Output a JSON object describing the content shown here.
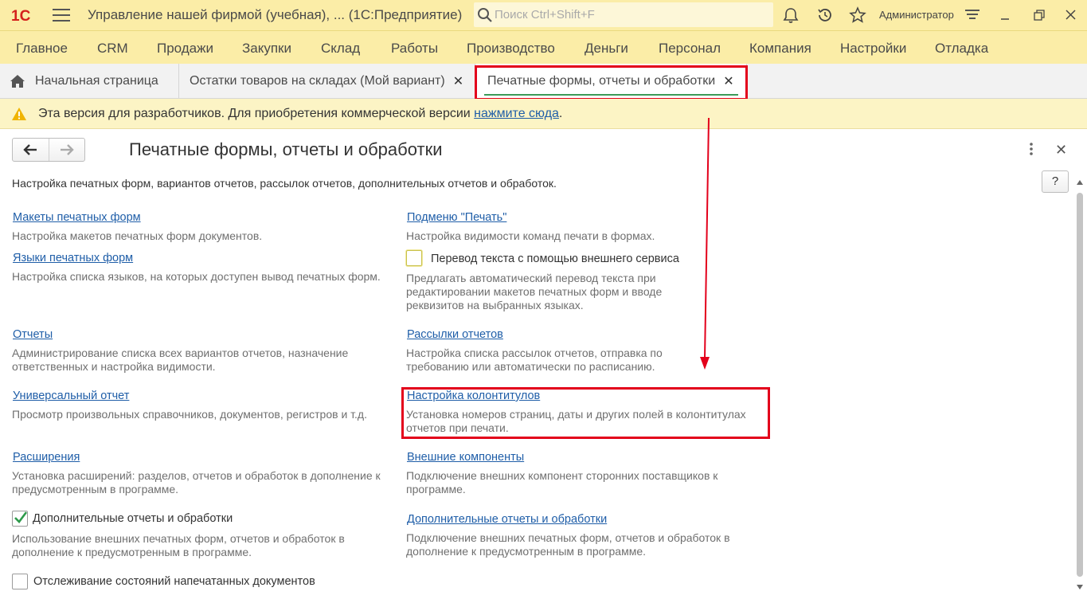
{
  "window": {
    "title": "Управление нашей фирмой (учебная), ...   (1С:Предприятие)",
    "logo_text": "1С",
    "user": "Администратор"
  },
  "search": {
    "placeholder": "Поиск Ctrl+Shift+F",
    "value": ""
  },
  "menu": {
    "items": [
      "Главное",
      "CRM",
      "Продажи",
      "Закупки",
      "Склад",
      "Работы",
      "Производство",
      "Деньги",
      "Персонал",
      "Компания",
      "Настройки",
      "Отладка"
    ]
  },
  "tabs": [
    {
      "label": "Начальная страница"
    },
    {
      "label": "Остатки товаров на складах (Мой вариант)"
    },
    {
      "label": "Печатные формы, отчеты и обработки"
    }
  ],
  "warning": {
    "text": "Эта версия для разработчиков. Для приобретения коммерческой версии ",
    "link": "нажмите сюда",
    "tail": "."
  },
  "form": {
    "title": "Печатные формы, отчеты и обработки",
    "help_label": "?",
    "intro": "Настройка печатных форм, вариантов отчетов, рассылок отчетов, дополнительных отчетов и обработок."
  },
  "left": {
    "makets": {
      "link": "Макеты печатных форм",
      "desc": "Настройка макетов печатных форм документов."
    },
    "languages": {
      "link": "Языки печатных форм",
      "desc": "Настройка списка языков, на которых доступен вывод печатных форм."
    },
    "reports": {
      "link": "Отчеты",
      "desc": "Администрирование списка всех вариантов отчетов, назначение ответственных и настройка видимости."
    },
    "universal": {
      "link": "Универсальный отчет",
      "desc": "Просмотр произвольных справочников, документов, регистров и т.д."
    },
    "extensions": {
      "link": "Расширения",
      "desc": "Установка расширений: разделов, отчетов и обработок в дополнение к предусмотренным в программе."
    },
    "additional": {
      "label": "Дополнительные отчеты и обработки",
      "checked": true,
      "desc": "Использование внешних печатных форм, отчетов и обработок в дополнение к предусмотренным в программе."
    },
    "tracking": {
      "label": "Отслеживание состояний напечатанных документов",
      "checked": false
    }
  },
  "right": {
    "submenu": {
      "link": "Подменю \"Печать\"",
      "desc": "Настройка видимости команд печати в формах."
    },
    "translate": {
      "label": "Перевод текста с помощью внешнего сервиса",
      "checked": false,
      "desc": "Предлагать автоматический перевод текста при редактировании макетов печатных форм и вводе реквизитов на выбранных языках."
    },
    "mailings": {
      "link": "Рассылки отчетов",
      "desc": "Настройка списка рассылок отчетов, отправка по требованию или автоматически по расписанию."
    },
    "headers": {
      "link": "Настройка колонтитулов",
      "desc": "Установка номеров страниц, даты и других полей в колонтитулах отчетов при печати."
    },
    "components": {
      "link": "Внешние компоненты",
      "desc": "Подключение внешних компонент сторонних поставщиков к программе."
    },
    "additional": {
      "link": "Дополнительные отчеты и обработки",
      "desc": "Подключение внешних печатных форм, отчетов и обработок в дополнение к предусмотренным в программе."
    }
  },
  "colors": {
    "header_bg": "#fbeda7",
    "link": "#1f5ea8",
    "highlight": "#e3001b",
    "check": "#2e9a4b"
  }
}
